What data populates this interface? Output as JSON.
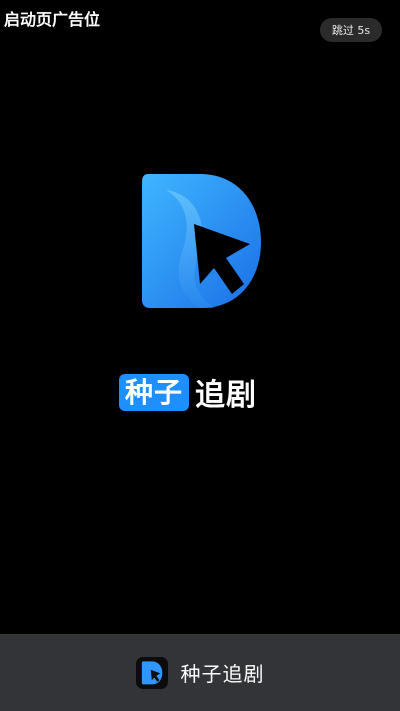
{
  "splash": {
    "ad_slot_label": "启动页广告位",
    "skip_button_label": "跳过 5s"
  },
  "brand": {
    "logo_icon": "play-d-logo-icon",
    "name_highlight": "种子",
    "name_rest": "追剧",
    "accent_color": "#1e8fff"
  },
  "footer": {
    "icon": "app-logo-icon",
    "app_title": "种子追剧"
  }
}
